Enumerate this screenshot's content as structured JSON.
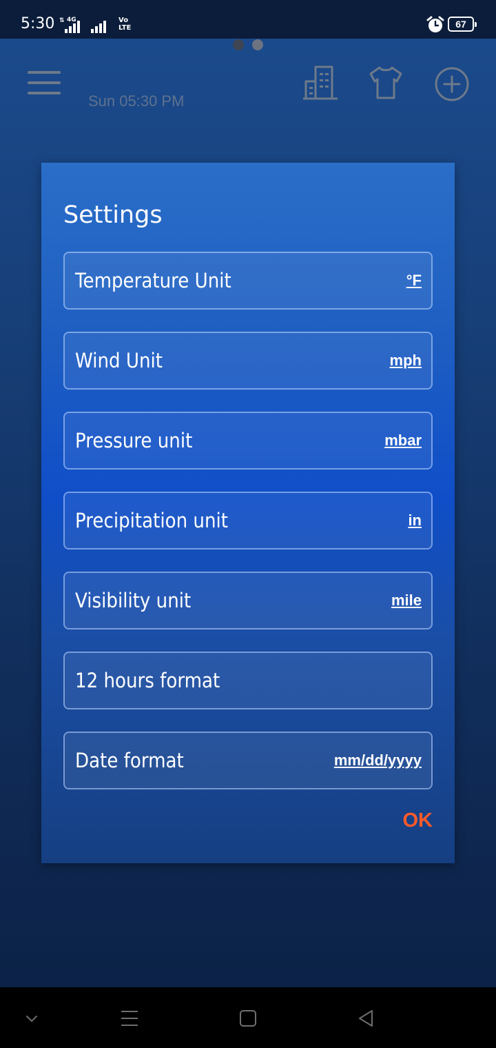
{
  "status_bar": {
    "time": "5:30",
    "network_type": "4G",
    "volte_top": "Vo",
    "volte_bottom": "LTE",
    "battery_level": "67",
    "icons": [
      "signal-icon",
      "signal-icon",
      "volte-icon",
      "alarm-icon",
      "battery-icon"
    ]
  },
  "header": {
    "date_time": "Sun 05:30 PM",
    "icons": [
      "menu-icon",
      "building-icon",
      "shirt-icon",
      "add-icon"
    ],
    "page_count": 2
  },
  "dialog": {
    "title": "Settings",
    "items": [
      {
        "label": "Temperature Unit",
        "value": "°F"
      },
      {
        "label": "Wind Unit",
        "value": "mph"
      },
      {
        "label": "Pressure unit",
        "value": "mbar"
      },
      {
        "label": "Precipitation unit",
        "value": "in"
      },
      {
        "label": "Visibility unit",
        "value": "mile"
      },
      {
        "label": "12 hours format",
        "value": ""
      },
      {
        "label": "Date format",
        "value": "mm/dd/yyyy"
      }
    ],
    "ok_label": "OK"
  },
  "nav_bar": {
    "icons": [
      "chevron-down-icon",
      "recent-apps-icon",
      "home-icon",
      "back-icon"
    ]
  },
  "colors": {
    "accent_ok": "#ff5a2a",
    "dialog_blue": "#1e5ec2",
    "background_navy": "#112e5c"
  }
}
